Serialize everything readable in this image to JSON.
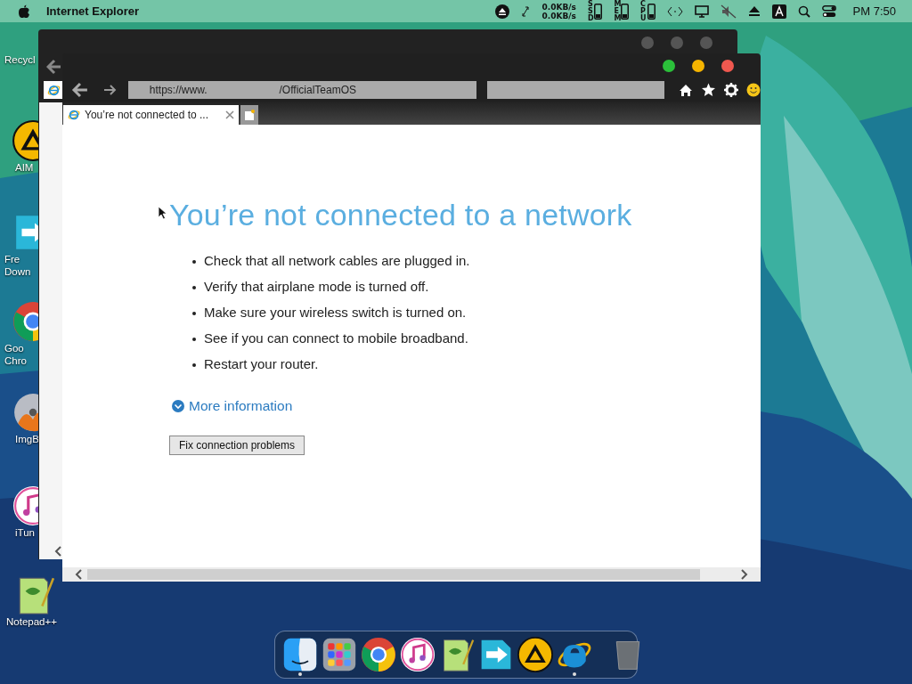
{
  "menu_bar": {
    "app_name": "Internet Explorer",
    "network_speed": [
      "0.0KB/s",
      "0.0KB/s"
    ],
    "meters": [
      "SSD",
      "MEM",
      "CPU"
    ],
    "clock": "PM 7:50"
  },
  "desktop_icons": [
    {
      "kind": "recycle",
      "lines": [
        "Recycl"
      ]
    },
    {
      "kind": "aim",
      "lines": [
        "AIM"
      ]
    },
    {
      "kind": "download",
      "lines": [
        "Fre",
        "Down"
      ]
    },
    {
      "kind": "chrome",
      "lines": [
        "Goo",
        "Chro"
      ]
    },
    {
      "kind": "disc",
      "lines": [
        "ImgB"
      ]
    },
    {
      "kind": "music",
      "lines": [
        "iTun"
      ]
    },
    {
      "kind": "notepad",
      "lines": [
        "Notepad++"
      ]
    }
  ],
  "browser": {
    "address": {
      "prefix": "https://www.",
      "suffix": "/OfficialTeamOS"
    },
    "tabs": [
      {
        "title": "You’re not connected to ...",
        "selected": true
      }
    ],
    "page": {
      "heading": "You’re not connected to a network",
      "tips": [
        "Check that all network cables are plugged in.",
        "Verify that airplane mode is turned off.",
        "Make sure your wireless switch is turned on.",
        "See if you can connect to mobile broadband.",
        "Restart your router."
      ],
      "more_link": "More information",
      "fix_button": "Fix connection problems"
    }
  },
  "dock": {
    "apps": [
      {
        "kind": "finder",
        "running": true
      },
      {
        "kind": "launchpad",
        "running": false
      },
      {
        "kind": "chrome",
        "running": false
      },
      {
        "kind": "music",
        "running": false
      },
      {
        "kind": "notepad",
        "running": false
      },
      {
        "kind": "download",
        "running": false
      },
      {
        "kind": "aim",
        "running": false
      },
      {
        "kind": "ie",
        "running": true
      },
      {
        "kind": "trash",
        "running": false
      }
    ]
  }
}
